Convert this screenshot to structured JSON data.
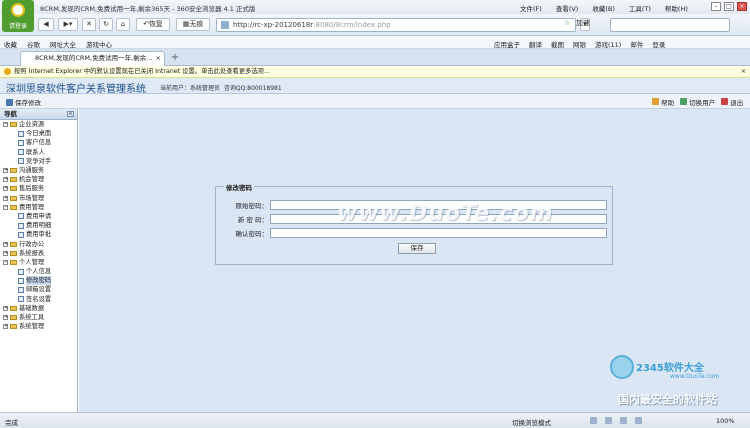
{
  "browser": {
    "title": "8CRM,发现的CRM,免费试用一年,剩余365天 - 360安全浏览器 4.1 正式版",
    "logo_label": "请登录",
    "menu": [
      "文件(F)",
      "查看(V)",
      "收藏(B)",
      "工具(T)",
      "帮助(H)"
    ],
    "restore_label": "恢复",
    "noimage_label": "无痕",
    "url_host": "http://rc-xp-20120618r",
    "url_path": ":8080/8crm/index.php",
    "accelerate_label": "加速",
    "favorites": [
      "收藏",
      "谷歌",
      "网址大全",
      "游戏中心"
    ],
    "right_tools": [
      "应用盒子",
      "翻译",
      "截图",
      "网银",
      "游戏(11)",
      "邮件",
      "登录"
    ],
    "tab_title": "8CRM,发现的CRM,免费试用一年,剩余...",
    "infobar": "按照 Internet Explorer 中的默认设置现在已关闭 Intranet 设置。单击此处查看更多选项...",
    "status_left": "完成",
    "status_mode": "切换浏览模式",
    "zoom": "100%"
  },
  "app": {
    "title": "深圳思泉软件客户关系管理系统",
    "user_label": "当前用户：系统管理员",
    "qq_label": "咨询QQ:800018981",
    "save_edit": "保存修改",
    "help": "帮助",
    "switch_user": "切换用户",
    "logout": "退出"
  },
  "sidebar": {
    "header": "导航",
    "collapse": "«",
    "tree": [
      {
        "label": "企业资源",
        "type": "group",
        "open": true
      },
      {
        "label": "今日桌面",
        "type": "leaf"
      },
      {
        "label": "客户信息",
        "type": "leaf"
      },
      {
        "label": "联系人",
        "type": "leaf"
      },
      {
        "label": "竞争对手",
        "type": "leaf"
      },
      {
        "label": "沟通服务",
        "type": "group",
        "open": false
      },
      {
        "label": "机会管理",
        "type": "group",
        "open": false
      },
      {
        "label": "售后服务",
        "type": "group",
        "open": false
      },
      {
        "label": "市场管理",
        "type": "group",
        "open": false
      },
      {
        "label": "费用管理",
        "type": "group",
        "open": true
      },
      {
        "label": "费用申请",
        "type": "leaf"
      },
      {
        "label": "费用明细",
        "type": "leaf"
      },
      {
        "label": "费用审批",
        "type": "leaf"
      },
      {
        "label": "行政办公",
        "type": "group",
        "open": false
      },
      {
        "label": "系统报表",
        "type": "group",
        "open": false
      },
      {
        "label": "个人管理",
        "type": "group",
        "open": true
      },
      {
        "label": "个人信息",
        "type": "leaf"
      },
      {
        "label": "修改密码",
        "type": "leaf",
        "selected": true
      },
      {
        "label": "邮箱设置",
        "type": "leaf"
      },
      {
        "label": "签名设置",
        "type": "leaf"
      },
      {
        "label": "基础数据",
        "type": "group",
        "open": false
      },
      {
        "label": "系统工具",
        "type": "group",
        "open": false
      },
      {
        "label": "系统管理",
        "type": "group",
        "open": false
      }
    ]
  },
  "form": {
    "legend": "修改密码",
    "old_password": "原始密码：",
    "new_password": "新 密 码：",
    "confirm_password": "确认密码：",
    "save": "保存"
  },
  "watermark": "www.DuoTe.com",
  "brand": {
    "name": "2345软件大全",
    "url": "www.DuoTe.com",
    "slogan": "国内最安全的软件站"
  }
}
